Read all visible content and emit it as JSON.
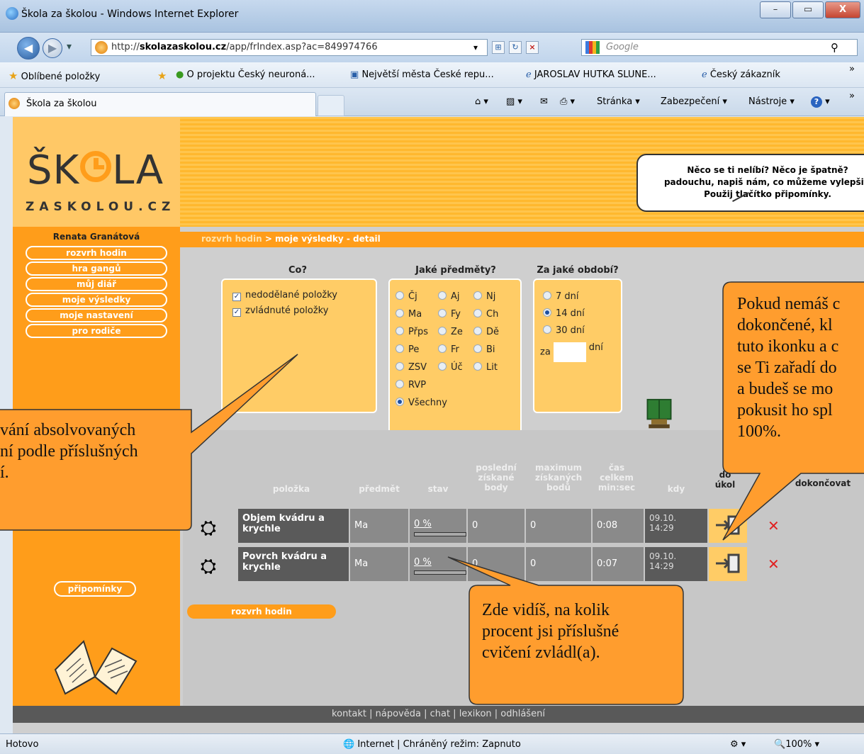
{
  "window": {
    "title": "Škola za školou - Windows Internet Explorer",
    "minimize_label": "–",
    "maximize_label": "▭",
    "close_label": "X"
  },
  "nav": {
    "back_label": "◀",
    "forward_label": "▶",
    "dropdown_label": "▾",
    "address_prefix": "http://",
    "address_domain": "skolazaskolou.cz",
    "address_path": "/app/frIndex.asp?ac=849974766",
    "search_placeholder": "Google",
    "search_button": "⚲"
  },
  "favorites": {
    "label": "Oblíbené položky",
    "items": [
      "O projektu Český neuroná...",
      "Největší města České repu...",
      "JAROSLAV HUTKA SLUNE...",
      "Český zákazník"
    ],
    "overflow": "»"
  },
  "tabs": {
    "active": "Škola za školou",
    "commands": [
      "Stránka ▾",
      "Zabezpečení ▾",
      "Nástroje ▾"
    ],
    "overflow": "»"
  },
  "site": {
    "logo_top": "ŠK",
    "logo_end": "LA",
    "logo_sub": "ZASKOLOU.CZ",
    "speech": [
      "Něco se ti nelíbí? Něco je špatně?",
      "padouchu, napiš nám, co můžeme vylepšit.",
      "Použij tlačítko připomínky."
    ],
    "user": "Renata Granátová",
    "menu": [
      "rozvrh hodin",
      "hra gangů",
      "můj diář",
      "moje výsledky",
      "moje nastavení",
      "pro rodiče"
    ],
    "feedback_button": "připomínky",
    "breadcrumb_link": "rozvrh hodin",
    "breadcrumb_rest": " > moje výsledky - detail",
    "footer": "kontakt | nápověda | chat | lexikon | odhlášení",
    "bottom_button": "rozvrh hodin"
  },
  "filters": {
    "what": {
      "title": "Co?",
      "options": [
        {
          "label": "nedodělané položky",
          "checked": true
        },
        {
          "label": "zvládnuté položky",
          "checked": true
        }
      ]
    },
    "subjects": {
      "title": "Jaké předměty?",
      "rows": [
        [
          "Čj",
          "Aj",
          "Nj"
        ],
        [
          "Ma",
          "Fy",
          "Ch"
        ],
        [
          "Přps",
          "Ze",
          "Dě"
        ],
        [
          "Pe",
          "Fr",
          "Bi"
        ],
        [
          "ZSV",
          "Úč",
          "Lit"
        ],
        [
          "RVP"
        ],
        [
          "Všechny"
        ]
      ],
      "selected": "Všechny"
    },
    "period": {
      "title": "Za jaké období?",
      "options": [
        "7 dní",
        "14 dní",
        "30 dní"
      ],
      "selected": "14 dní",
      "custom_prefix": "za",
      "custom_suffix": "dní"
    }
  },
  "table": {
    "headers": {
      "item": "položka",
      "subject": "předmět",
      "status": "stav",
      "last": [
        "poslední",
        "získané",
        "body"
      ],
      "max": [
        "maximum",
        "získaných",
        "bodů"
      ],
      "time": [
        "čas",
        "celkem",
        "min:sec"
      ],
      "when": "kdy",
      "todo": [
        "do",
        "úkol"
      ],
      "finish": "dokončovat"
    },
    "rows": [
      {
        "name": "Objem kvádru a krychle",
        "subject": "Ma",
        "status": "0 %",
        "progress": 0,
        "last": "0",
        "max": "0",
        "time": "0:08",
        "date": "09.10.",
        "clock": "14:29"
      },
      {
        "name": "Povrch kvádru a krychle",
        "subject": "Ma",
        "status": "0 %",
        "progress": 0,
        "last": "0",
        "max": "0",
        "time": "0:07",
        "date": "09.10.",
        "clock": "14:29"
      }
    ],
    "delete_symbol": "✕"
  },
  "callouts": {
    "left": [
      "vání absolvovaných",
      "ní podle příslušných",
      "í."
    ],
    "right": [
      "Pokud nemáš c",
      "dokončené, kl",
      "tuto ikonku a c",
      "se Ti zařadí do",
      "a budeš se mo",
      "pokusit ho spl",
      "100%."
    ],
    "bottom": [
      "Zde vidíš, na kolik",
      "procent jsi příslušné",
      "cvičení zvládl(a)."
    ]
  },
  "status": {
    "left": "Hotovo",
    "zone": "Internet | Chráněný režim: Zapnuto",
    "zoom": "100%"
  },
  "colors": {
    "orange": "#ff9d1a",
    "panel": "#ffcc66",
    "callout": "#ff9d2e",
    "table_dark": "#5a5a5a",
    "table_mid": "#8a8a8a",
    "delete": "#e02020"
  }
}
